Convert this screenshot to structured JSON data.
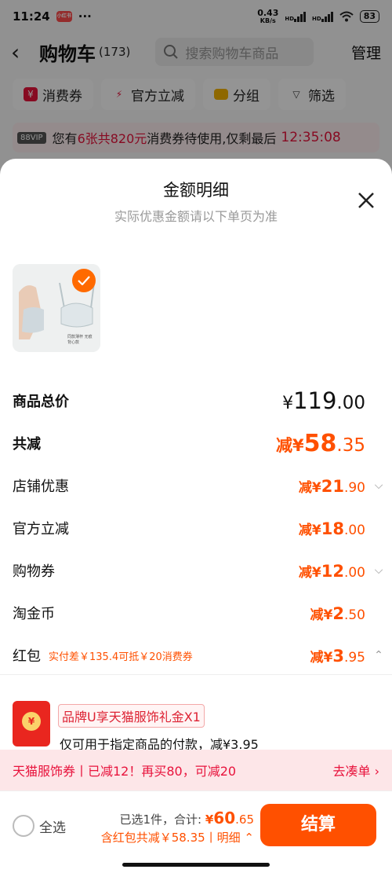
{
  "status": {
    "time": "11:24",
    "app_badge": "小红书",
    "dots": "···",
    "net_speed_top": "0.43",
    "net_speed_unit": "KB/s",
    "sig1": "HD",
    "sig2": "HD",
    "battery": "83"
  },
  "nav": {
    "back_icon": "‹",
    "title": "购物车",
    "count": "(173)",
    "search_placeholder": "搜索购物车商品",
    "manage": "管理"
  },
  "chips": [
    {
      "icon": "¥",
      "label": "消费券"
    },
    {
      "icon": "⚡",
      "label": "官方立减"
    },
    {
      "icon": "▬",
      "label": "分组"
    },
    {
      "icon": "▽",
      "label": "筛选"
    }
  ],
  "promo": {
    "vip": "88VIP",
    "prefix": "您有",
    "highlight": "6张共820元",
    "suffix": "消费券待使用,仅剩最后",
    "timer": "12:35:08"
  },
  "sheet": {
    "title": "金额明细",
    "subtitle": "实际优惠金额请以下单页为准",
    "product_thumb_text": "同款薄杯 无痕背心款",
    "rows": [
      {
        "label": "商品总价",
        "currency": "¥",
        "int": "119",
        "dec": ".00"
      },
      {
        "label": "共减",
        "prefix": "减¥",
        "int": "58",
        "dec": ".35"
      },
      {
        "label": "店铺优惠",
        "prefix": "减¥",
        "int": "21",
        "dec": ".90"
      },
      {
        "label": "官方立减",
        "prefix": "减¥",
        "int": "18",
        "dec": ".00"
      },
      {
        "label": "购物券",
        "prefix": "减¥",
        "int": "12",
        "dec": ".00"
      },
      {
        "label": "淘金币",
        "prefix": "减¥",
        "int": "2",
        "dec": ".50"
      },
      {
        "label": "红包",
        "note": "实付差￥135.4可抵￥20消费券",
        "prefix": "减¥",
        "int": "3",
        "dec": ".95"
      }
    ],
    "gift": {
      "tag": "品牌U享天猫服饰礼金X1",
      "desc": "仅可用于指定商品的付款，减¥3.95"
    }
  },
  "bottom_promo": {
    "text": "天猫服饰券丨已减12！再买80，可减20",
    "cta": "去凑单 ›"
  },
  "footer": {
    "select_all": "全选",
    "selected": "已选1件，合计:",
    "total_currency": "¥",
    "total_int": "60",
    "total_dec": ".65",
    "detail_line": "含红包共减￥58.35丨明细 ⌃",
    "checkout": "结算"
  },
  "colors": {
    "accent": "#ff5000",
    "promo_red": "#e8133c"
  }
}
